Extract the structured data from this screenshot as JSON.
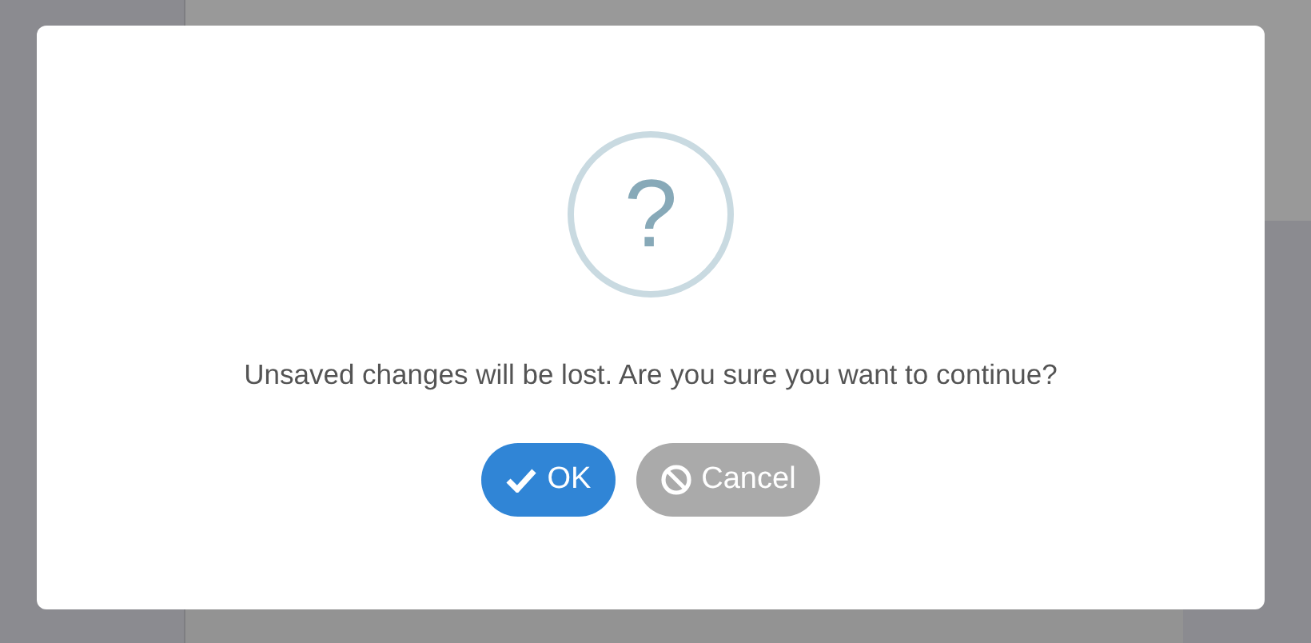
{
  "dialog": {
    "icon_text": "?",
    "message": "Unsaved changes will be lost. Are you sure you want to continue?",
    "buttons": [
      {
        "label": "OK",
        "kind": "confirm"
      },
      {
        "label": "Cancel",
        "kind": "cancel"
      }
    ]
  }
}
